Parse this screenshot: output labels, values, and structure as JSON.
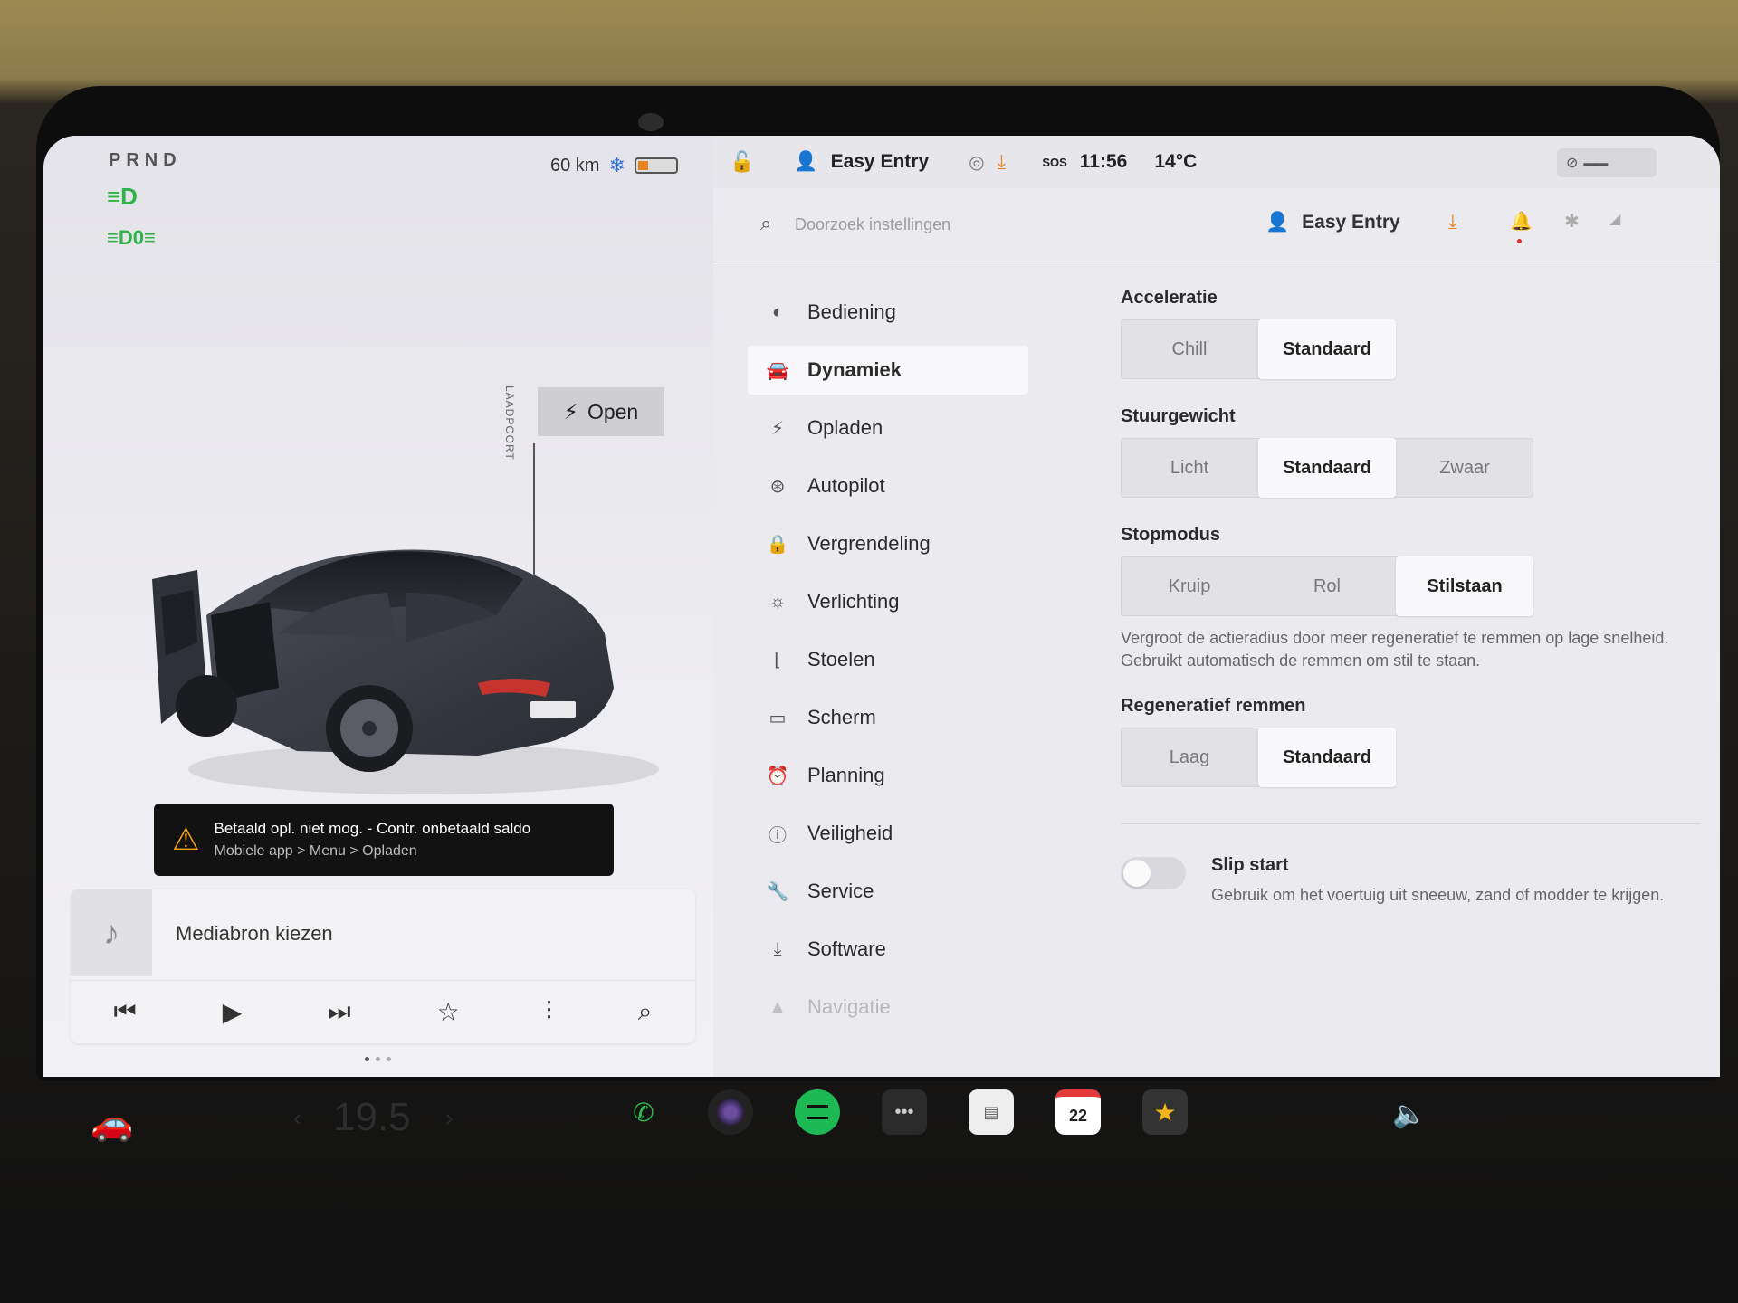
{
  "status": {
    "gear": "PRND",
    "range": "60 km",
    "battery_percent": 25,
    "profile": "Easy Entry",
    "sos": "SOS",
    "time": "11:56",
    "temperature": "14°C"
  },
  "car_view": {
    "laadpoort_label": "LAADPOORT",
    "open_label": "Open"
  },
  "alert": {
    "title": "Betaald opl. niet mog. - Contr. onbetaald saldo",
    "subtitle": "Mobiele app > Menu > Opladen"
  },
  "media": {
    "title": "Mediabron kiezen"
  },
  "settings": {
    "search_placeholder": "Doorzoek instellingen",
    "profile": "Easy Entry",
    "menu": [
      {
        "label": "Bediening",
        "icon": "toggle-icon"
      },
      {
        "label": "Dynamiek",
        "icon": "car-icon"
      },
      {
        "label": "Opladen",
        "icon": "bolt-icon"
      },
      {
        "label": "Autopilot",
        "icon": "steering-wheel-icon"
      },
      {
        "label": "Vergrendeling",
        "icon": "lock-icon"
      },
      {
        "label": "Verlichting",
        "icon": "sun-icon"
      },
      {
        "label": "Stoelen",
        "icon": "seat-icon"
      },
      {
        "label": "Scherm",
        "icon": "display-icon"
      },
      {
        "label": "Planning",
        "icon": "clock-icon"
      },
      {
        "label": "Veiligheid",
        "icon": "info-icon"
      },
      {
        "label": "Service",
        "icon": "wrench-icon"
      },
      {
        "label": "Software",
        "icon": "download-icon"
      },
      {
        "label": "Navigatie",
        "icon": "navigation-icon"
      }
    ],
    "acceleratie": {
      "title": "Acceleratie",
      "options": [
        "Chill",
        "Standaard"
      ],
      "selected": "Standaard"
    },
    "stuurgewicht": {
      "title": "Stuurgewicht",
      "options": [
        "Licht",
        "Standaard",
        "Zwaar"
      ],
      "selected": "Standaard"
    },
    "stopmodus": {
      "title": "Stopmodus",
      "options": [
        "Kruip",
        "Rol",
        "Stilstaan"
      ],
      "selected": "Stilstaan",
      "description": "Vergroot de actieradius door meer regeneratief te remmen op lage snelheid. Gebruikt automatisch de remmen om stil te staan."
    },
    "regeneratief": {
      "title": "Regeneratief remmen",
      "options": [
        "Laag",
        "Standaard"
      ],
      "selected": "Standaard"
    },
    "slip_start": {
      "title": "Slip start",
      "description": "Gebruik om het voertuig uit sneeuw, zand of modder te krijgen.",
      "enabled": false
    }
  },
  "dock": {
    "climate_temp": "19.5",
    "calendar_day": "22"
  },
  "colors": {
    "accent_orange": "#e8811f",
    "lamp_green": "#32b34a",
    "spotify_green": "#1db954",
    "warning_yellow": "#f2a31a"
  }
}
